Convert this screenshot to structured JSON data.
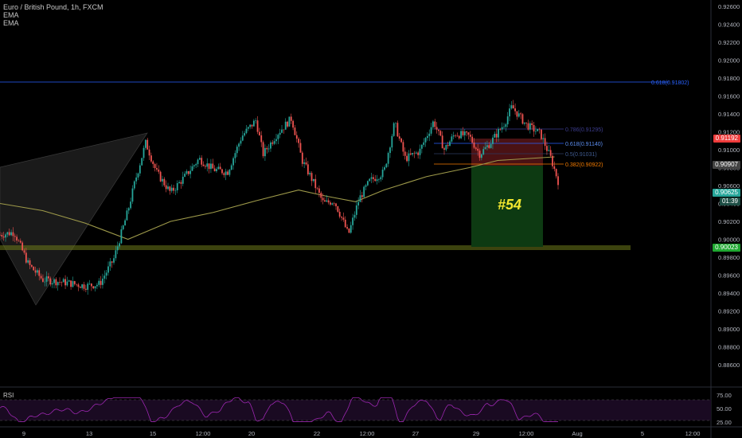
{
  "legend": {
    "title": "Euro / British Pound, 1h, FXCM",
    "indicators": [
      "EMA",
      "EMA"
    ]
  },
  "price_axis": {
    "ticks": [
      "0.92600",
      "0.92400",
      "0.92200",
      "0.92000",
      "0.91800",
      "0.91600",
      "0.91400",
      "0.91200",
      "0.91000",
      "0.90800",
      "0.90600",
      "0.90400",
      "0.90200",
      "0.90000",
      "0.89800",
      "0.89600",
      "0.89400",
      "0.89200",
      "0.89000",
      "0.88800",
      "0.88600"
    ]
  },
  "time_axis": {
    "ticks": [
      "9",
      "13",
      "15",
      "12:00",
      "20",
      "22",
      "12:00",
      "27",
      "29",
      "12:00",
      "Aug",
      "5",
      "12:00"
    ]
  },
  "rsi": {
    "label": "RSI",
    "ticks": [
      "75.00",
      "50.00",
      "25.00"
    ]
  },
  "badges": {
    "stop": "0.91192",
    "entry": "0.90907",
    "current": "0.90625",
    "countdown": "01:39",
    "target": "0.90023"
  },
  "fib": {
    "upper": "0.618(0.91802)",
    "l1": "0.786(0.91295)",
    "l2": "0.618(0.91140)",
    "l3": "0.5(0.91031)",
    "l4": "0.382(0.90922)"
  },
  "annotation": "#54",
  "colors": {
    "background": "#000000",
    "up": "#26a69a",
    "down": "#ef5350",
    "ema": "#9e9a4a",
    "rsi_line": "#9c27b0",
    "stop_zone": "#4a1214",
    "target_zone": "#0d3a12",
    "support": "#6e7a1a"
  },
  "chart_data": {
    "type": "candlestick",
    "title": "Euro / British Pound, 1h, FXCM",
    "ylim": [
      0.885,
      0.927
    ],
    "key_levels": {
      "fib_0_618_upper": 0.91802,
      "fib_0_786": 0.91295,
      "fib_0_618": 0.9114,
      "fib_0_5": 0.91031,
      "fib_0_382": 0.90922,
      "stop": 0.91192,
      "entry": 0.90907,
      "current": 0.90625,
      "target": 0.90023
    },
    "price_path": [
      [
        0,
        0.9005
      ],
      [
        0.02,
        0.9008
      ],
      [
        0.04,
        0.8972
      ],
      [
        0.06,
        0.8955
      ],
      [
        0.09,
        0.8952
      ],
      [
        0.12,
        0.8948
      ],
      [
        0.14,
        0.895
      ],
      [
        0.16,
        0.8978
      ],
      [
        0.18,
        0.9032
      ],
      [
        0.19,
        0.9065
      ],
      [
        0.205,
        0.9108
      ],
      [
        0.22,
        0.9075
      ],
      [
        0.24,
        0.9052
      ],
      [
        0.26,
        0.907
      ],
      [
        0.28,
        0.909
      ],
      [
        0.3,
        0.9078
      ],
      [
        0.32,
        0.9075
      ],
      [
        0.34,
        0.9115
      ],
      [
        0.36,
        0.9133
      ],
      [
        0.37,
        0.9095
      ],
      [
        0.39,
        0.9118
      ],
      [
        0.41,
        0.9135
      ],
      [
        0.425,
        0.9088
      ],
      [
        0.44,
        0.9065
      ],
      [
        0.455,
        0.904
      ],
      [
        0.47,
        0.9043
      ],
      [
        0.48,
        0.9025
      ],
      [
        0.49,
        0.9005
      ],
      [
        0.505,
        0.9045
      ],
      [
        0.52,
        0.9065
      ],
      [
        0.54,
        0.9075
      ],
      [
        0.555,
        0.913
      ],
      [
        0.57,
        0.909
      ],
      [
        0.59,
        0.9098
      ],
      [
        0.61,
        0.9132
      ],
      [
        0.625,
        0.91
      ],
      [
        0.64,
        0.9118
      ],
      [
        0.66,
        0.9115
      ],
      [
        0.675,
        0.9095
      ],
      [
        0.69,
        0.9108
      ],
      [
        0.71,
        0.913
      ],
      [
        0.72,
        0.9148
      ],
      [
        0.74,
        0.9128
      ],
      [
        0.76,
        0.9118
      ],
      [
        0.775,
        0.909
      ],
      [
        0.785,
        0.9065
      ]
    ],
    "ema_path": [
      [
        0,
        0.904
      ],
      [
        0.06,
        0.9032
      ],
      [
        0.12,
        0.9018
      ],
      [
        0.18,
        0.9
      ],
      [
        0.24,
        0.902
      ],
      [
        0.3,
        0.903
      ],
      [
        0.36,
        0.9043
      ],
      [
        0.42,
        0.9055
      ],
      [
        0.46,
        0.9048
      ],
      [
        0.5,
        0.9042
      ],
      [
        0.54,
        0.9055
      ],
      [
        0.6,
        0.907
      ],
      [
        0.66,
        0.908
      ],
      [
        0.7,
        0.9088
      ],
      [
        0.74,
        0.909
      ],
      [
        0.78,
        0.9092
      ]
    ]
  }
}
